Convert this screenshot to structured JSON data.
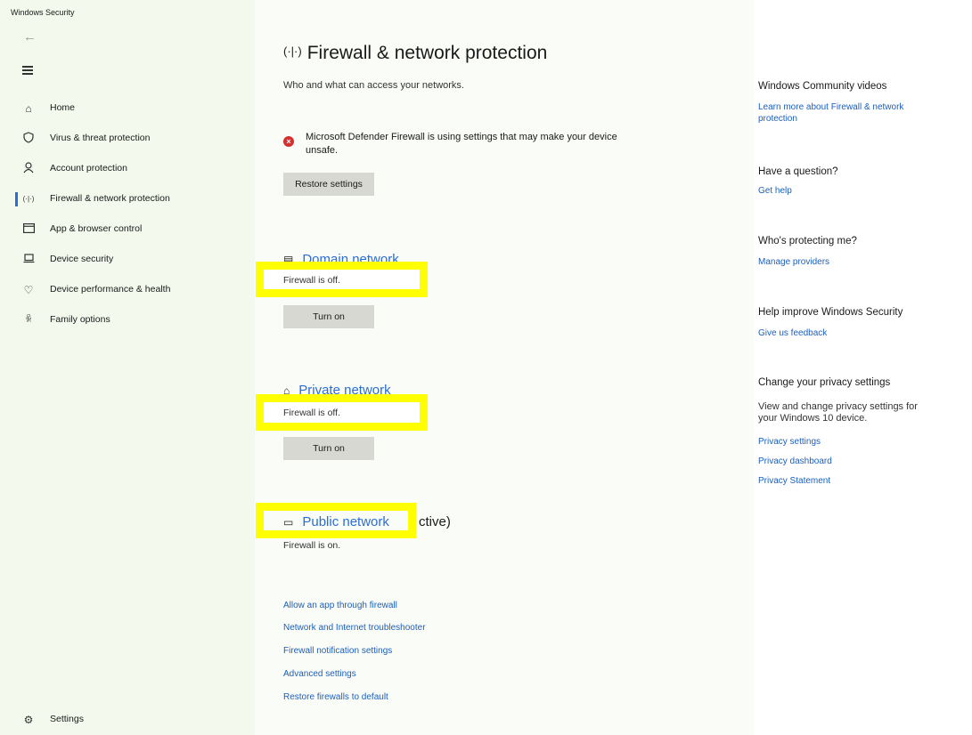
{
  "window": {
    "title": "Windows Security",
    "minimize_icon": "minimize-icon",
    "restore_icon": "restore-icon",
    "close_icon": "close-icon"
  },
  "sidebar": {
    "items": [
      {
        "label": "Home",
        "icon": "home-icon"
      },
      {
        "label": "Virus & threat protection",
        "icon": "shield-icon"
      },
      {
        "label": "Account protection",
        "icon": "person-icon"
      },
      {
        "label": "Firewall & network protection",
        "icon": "antenna-icon",
        "active": true
      },
      {
        "label": "App & browser control",
        "icon": "browser-window-icon"
      },
      {
        "label": "Device security",
        "icon": "laptop-icon"
      },
      {
        "label": "Device performance & health",
        "icon": "heart-icon"
      },
      {
        "label": "Family options",
        "icon": "family-icon"
      }
    ],
    "settings": {
      "label": "Settings",
      "icon": "gear-icon"
    }
  },
  "main": {
    "title": "Firewall & network protection",
    "subtitle": "Who and what can access your networks.",
    "warning": {
      "text": "Microsoft Defender Firewall is using settings that may make your device unsafe.",
      "button": "Restore settings"
    },
    "networks": [
      {
        "name": "Domain network",
        "status": "Firewall is off.",
        "button": "Turn on",
        "icon": "domain-network-icon"
      },
      {
        "name": "Private network",
        "status": "Firewall is off.",
        "button": "Turn on",
        "icon": "private-network-icon"
      },
      {
        "name": "Public network",
        "suffix": "ctive)",
        "status": "Firewall is on.",
        "icon": "public-network-icon"
      }
    ],
    "links": [
      "Allow an app through firewall",
      "Network and Internet troubleshooter",
      "Firewall notification settings",
      "Advanced settings",
      "Restore firewalls to default"
    ]
  },
  "side_panel": {
    "community": {
      "heading": "Windows Community videos",
      "link": "Learn more about Firewall & network protection"
    },
    "question": {
      "heading": "Have a question?",
      "link": "Get help"
    },
    "protecting": {
      "heading": "Who's protecting me?",
      "link": "Manage providers"
    },
    "improve": {
      "heading": "Help improve Windows Security",
      "link": "Give us feedback"
    },
    "privacy": {
      "heading": "Change your privacy settings",
      "text": "View and change privacy settings for your Windows 10 device.",
      "links": [
        "Privacy settings",
        "Privacy dashboard",
        "Privacy Statement"
      ]
    }
  },
  "colors": {
    "sidebar_bg": "#f3f9ec",
    "accent": "#2a6ed3",
    "highlight": "#ffff00",
    "error": "#d32f2f"
  }
}
